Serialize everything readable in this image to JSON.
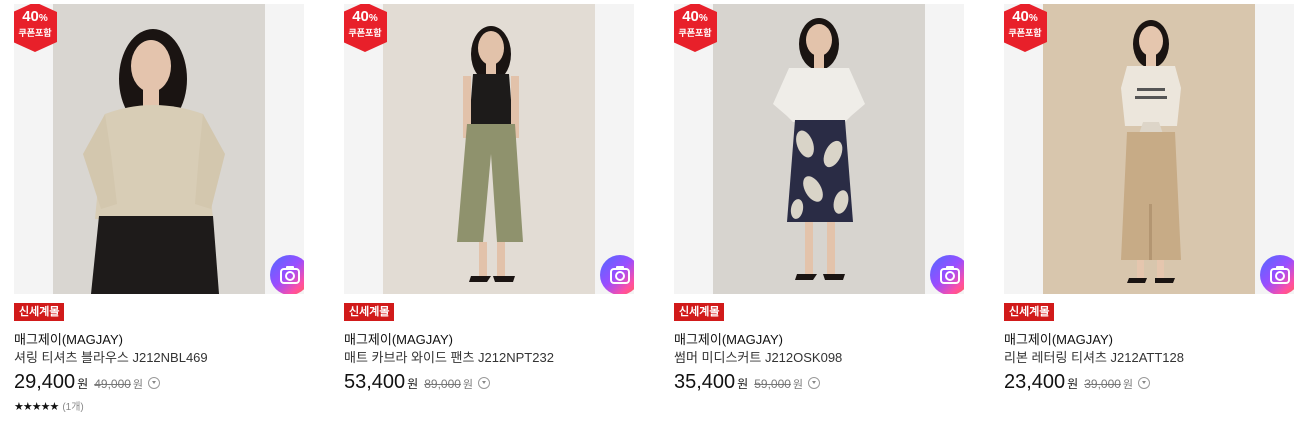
{
  "products": [
    {
      "discount_percent": "40",
      "discount_unit": "%",
      "discount_note": "쿠폰포함",
      "tag": "신세계몰",
      "brand": "매그제이(MAGJAY)",
      "name": "셔링 티셔츠 블라우스 J212NBL469",
      "price": "29,400",
      "price_unit": "원",
      "original_price": "49,000",
      "original_unit": "원",
      "rating_stars": "★★★★★",
      "review_count": "(1개)",
      "colors": {
        "bg": "#d9d6d1",
        "top": "#d8cdb6",
        "bottom": "#1e1b1a",
        "skin": "#e4c4ad",
        "hair": "#1a1412"
      }
    },
    {
      "discount_percent": "40",
      "discount_unit": "%",
      "discount_note": "쿠폰포함",
      "tag": "신세계몰",
      "brand": "매그제이(MAGJAY)",
      "name": "매트 카브라 와이드 팬츠 J212NPT232",
      "price": "53,400",
      "price_unit": "원",
      "original_price": "89,000",
      "original_unit": "원",
      "colors": {
        "bg": "#e2dcd4",
        "top": "#1d1b1a",
        "bottom": "#8f926d",
        "skin": "#e2c2aa",
        "hair": "#1a1412"
      }
    },
    {
      "discount_percent": "40",
      "discount_unit": "%",
      "discount_note": "쿠폰포함",
      "tag": "신세계몰",
      "brand": "매그제이(MAGJAY)",
      "name": "썸머 미디스커트 J212OSK098",
      "price": "35,400",
      "price_unit": "원",
      "original_price": "59,000",
      "original_unit": "원",
      "colors": {
        "bg": "#d7d4cf",
        "top": "#efede8",
        "bottom": "#2a2c45",
        "skin": "#e3c3ab",
        "hair": "#1a1412"
      }
    },
    {
      "discount_percent": "40",
      "discount_unit": "%",
      "discount_note": "쿠폰포함",
      "tag": "신세계몰",
      "brand": "매그제이(MAGJAY)",
      "name": "리본 레터링 티셔츠 J212ATT128",
      "price": "23,400",
      "price_unit": "원",
      "original_price": "39,000",
      "original_unit": "원",
      "colors": {
        "bg": "#d8c6ad",
        "top": "#ece6dc",
        "bottom": "#c7ab86",
        "skin": "#e5c6ae",
        "hair": "#1a1412"
      }
    }
  ],
  "theme": {
    "badge_red": "#e8202a",
    "tag_red": "#d11a1a"
  }
}
